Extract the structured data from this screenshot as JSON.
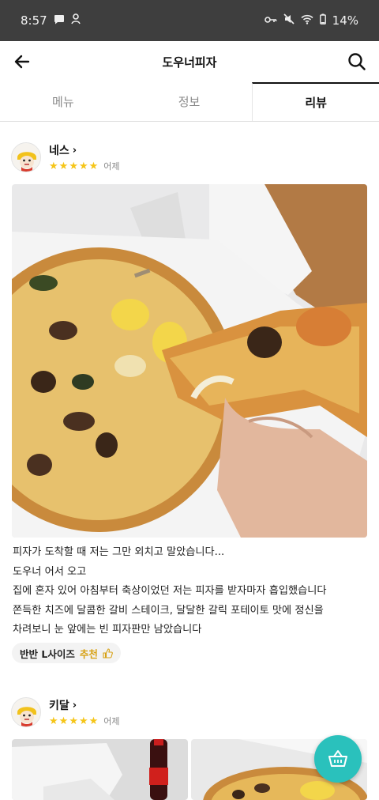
{
  "status_bar": {
    "time": "8:57",
    "battery": "14%",
    "icons": [
      "chat-bubble-icon",
      "notification-icon",
      "vpn-key-icon",
      "mute-icon",
      "wifi-icon",
      "battery-icon"
    ]
  },
  "header": {
    "title": "도우너피자",
    "back_icon": "arrow-left-icon",
    "search_icon": "search-icon"
  },
  "tabs": [
    {
      "label": "메뉴",
      "active": false
    },
    {
      "label": "정보",
      "active": false
    },
    {
      "label": "리뷰",
      "active": true
    }
  ],
  "reviews": [
    {
      "nickname": "네스",
      "rating": 5,
      "date": "어제",
      "text_lines": [
        "피자가 도착할 때 저는 그만 외치고 말았습니다...",
        "도우너 어서 오고",
        "집에 혼자 있어 아침부터 축상이었던 저는 피자를 받자마자 흡입했습니다",
        "쫀득한 치즈에 달콤한 갈비 스테이크, 달달한 갈릭 포테이토 맛에 정신을",
        "차려보니 눈 앞에는 빈 피자판만 남았습니다"
      ],
      "menu_tag": {
        "name": "반반 L사이즈",
        "recommend": "추천"
      }
    },
    {
      "nickname": "키달",
      "rating": 5,
      "date": "어제"
    }
  ],
  "colors": {
    "accent": "#2ac1bc",
    "star": "#f5c518",
    "status_bar": "#3e3e3e"
  },
  "fab_icon": "shopping-basket-icon"
}
